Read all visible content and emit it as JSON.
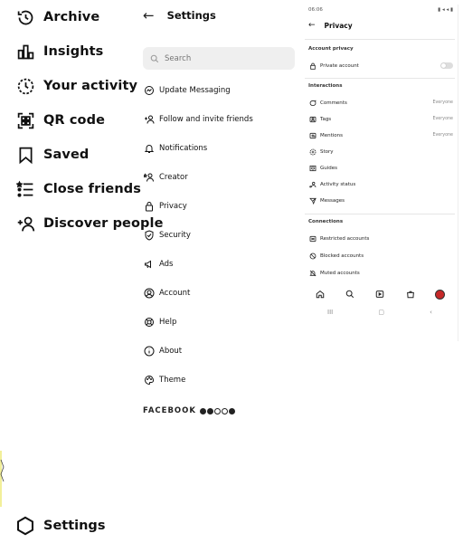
{
  "menu": {
    "items": [
      {
        "label": "Archive",
        "icon": "archive-icon"
      },
      {
        "label": "Insights",
        "icon": "insights-icon"
      },
      {
        "label": "Your activity",
        "icon": "activity-icon"
      },
      {
        "label": "QR code",
        "icon": "qr-code-icon"
      },
      {
        "label": "Saved",
        "icon": "bookmark-icon"
      },
      {
        "label": "Close friends",
        "icon": "close-friends-icon"
      },
      {
        "label": "Discover people",
        "icon": "add-person-icon"
      }
    ],
    "settings_label": "Settings"
  },
  "settings": {
    "title": "Settings",
    "search_placeholder": "Search",
    "items": [
      {
        "label": "Update Messaging",
        "icon": "messenger-icon"
      },
      {
        "label": "Follow and invite friends",
        "icon": "add-person-icon"
      },
      {
        "label": "Notifications",
        "icon": "bell-icon"
      },
      {
        "label": "Creator",
        "icon": "creator-icon"
      },
      {
        "label": "Privacy",
        "icon": "lock-icon"
      },
      {
        "label": "Security",
        "icon": "shield-icon"
      },
      {
        "label": "Ads",
        "icon": "megaphone-icon"
      },
      {
        "label": "Account",
        "icon": "account-icon"
      },
      {
        "label": "Help",
        "icon": "help-icon"
      },
      {
        "label": "About",
        "icon": "info-icon"
      },
      {
        "label": "Theme",
        "icon": "palette-icon"
      }
    ],
    "footer_label": "FACEBOOK"
  },
  "phone": {
    "status_time": "06:06",
    "status_right": "▮ ◂ ◂ ▮",
    "title": "Privacy",
    "sections": {
      "account_privacy": "Account privacy",
      "interactions": "Interactions",
      "connections": "Connections"
    },
    "private_account_label": "Private account",
    "interaction_rows": [
      {
        "label": "Comments",
        "value": "Everyone",
        "icon": "comment-icon"
      },
      {
        "label": "Tags",
        "value": "Everyone",
        "icon": "tag-icon"
      },
      {
        "label": "Mentions",
        "value": "Everyone",
        "icon": "mention-icon"
      },
      {
        "label": "Story",
        "value": "",
        "icon": "story-icon"
      },
      {
        "label": "Guides",
        "value": "",
        "icon": "guides-icon"
      },
      {
        "label": "Activity status",
        "value": "",
        "icon": "activity-status-icon"
      },
      {
        "label": "Messages",
        "value": "",
        "icon": "send-icon"
      }
    ],
    "connection_rows": [
      {
        "label": "Restricted accounts",
        "icon": "restricted-icon"
      },
      {
        "label": "Blocked accounts",
        "icon": "blocked-icon"
      },
      {
        "label": "Muted accounts",
        "icon": "muted-icon"
      }
    ],
    "nav": {
      "recents": "III",
      "home": "▢",
      "back": "‹"
    }
  },
  "colors": {
    "text": "#111111",
    "search_bg": "#efefef",
    "avatar": "#c62828",
    "muted": "#888888"
  }
}
